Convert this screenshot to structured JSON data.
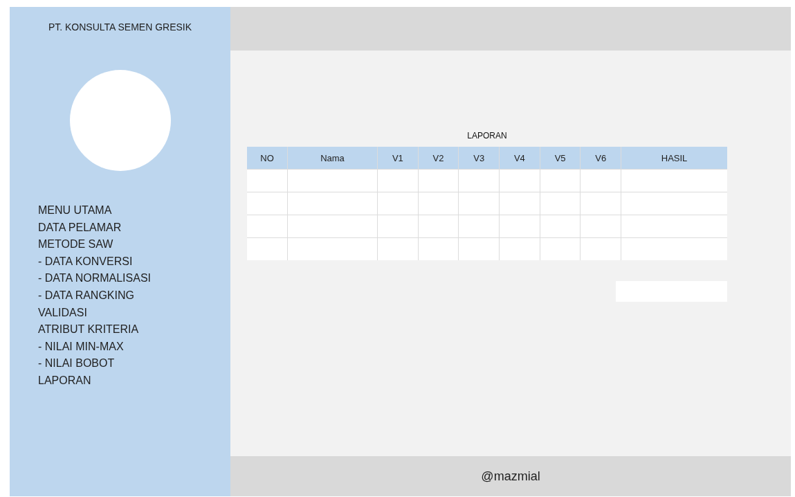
{
  "sidebar": {
    "company": "PT. KONSULTA SEMEN GRESIK",
    "menu": [
      "MENU UTAMA",
      "DATA PELAMAR",
      "METODE SAW",
      "- DATA KONVERSI",
      "- DATA NORMALISASI",
      "- DATA RANGKING",
      "VALIDASI",
      "ATRIBUT KRITERIA",
      "- NILAI MIN-MAX",
      "- NILAI BOBOT",
      "LAPORAN"
    ]
  },
  "report": {
    "title": "LAPORAN",
    "table": {
      "columns": [
        "NO",
        "Nama",
        "V1",
        "V2",
        "V3",
        "V4",
        "V5",
        "V6",
        "HASIL"
      ]
    }
  },
  "footer": "@mazmial"
}
